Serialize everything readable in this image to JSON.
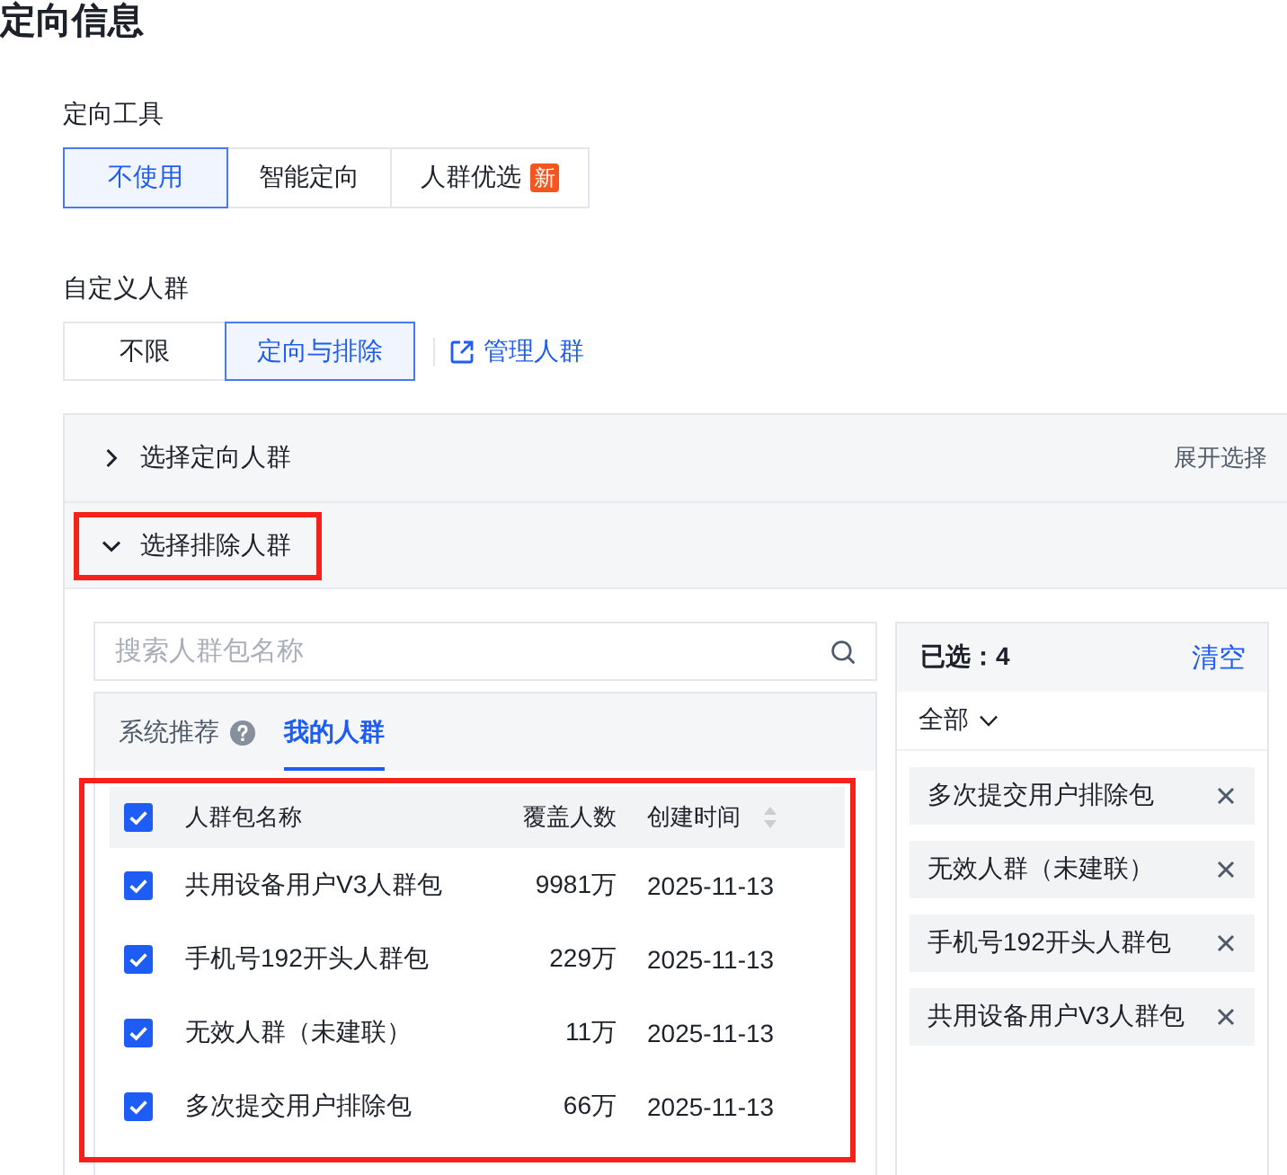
{
  "title": "定向信息",
  "targeting_tool": {
    "label": "定向工具",
    "options": [
      {
        "label": "不使用",
        "selected": true
      },
      {
        "label": "智能定向",
        "selected": false
      },
      {
        "label": "人群优选",
        "selected": false,
        "badge": "新"
      }
    ]
  },
  "custom_audience": {
    "label": "自定义人群",
    "options": [
      {
        "label": "不限",
        "selected": false
      },
      {
        "label": "定向与排除",
        "selected": true
      }
    ],
    "link": "管理人群"
  },
  "sections": [
    {
      "title": "选择定向人群",
      "expanded": false,
      "highlighted": false,
      "action": "展开选择"
    },
    {
      "title": "选择排除人群",
      "expanded": true,
      "highlighted": true,
      "picker": {
        "search": {
          "placeholder": "搜索人群包名称"
        },
        "tabs": [
          {
            "label": "系统推荐",
            "selected": false,
            "help": true
          },
          {
            "label": "我的人群",
            "selected": true,
            "help": false
          }
        ],
        "table": {
          "highlighted": true,
          "all_checked": true,
          "columns": [
            {
              "label": "人群包名称",
              "sortable": false
            },
            {
              "label": "覆盖人数",
              "sortable": false
            },
            {
              "label": "创建时间",
              "sortable": true
            }
          ],
          "rows": [
            {
              "checked": true,
              "cells": [
                "共用设备用户V3人群包",
                "9981万",
                "2025-11-13"
              ]
            },
            {
              "checked": true,
              "cells": [
                "手机号192开头人群包",
                "229万",
                "2025-11-13"
              ]
            },
            {
              "checked": true,
              "cells": [
                "无效人群（未建联）",
                "11万",
                "2025-11-13"
              ]
            },
            {
              "checked": true,
              "cells": [
                "多次提交用户排除包",
                "66万",
                "2025-11-13"
              ]
            }
          ]
        },
        "selection": {
          "count_label": "已选：4",
          "clear": "清空",
          "filter": "全部",
          "items": [
            {
              "label": "多次提交用户排除包"
            },
            {
              "label": "无效人群（未建联）"
            },
            {
              "label": "手机号192开头人群包"
            },
            {
              "label": "共用设备用户V3人群包"
            }
          ]
        }
      }
    }
  ]
}
